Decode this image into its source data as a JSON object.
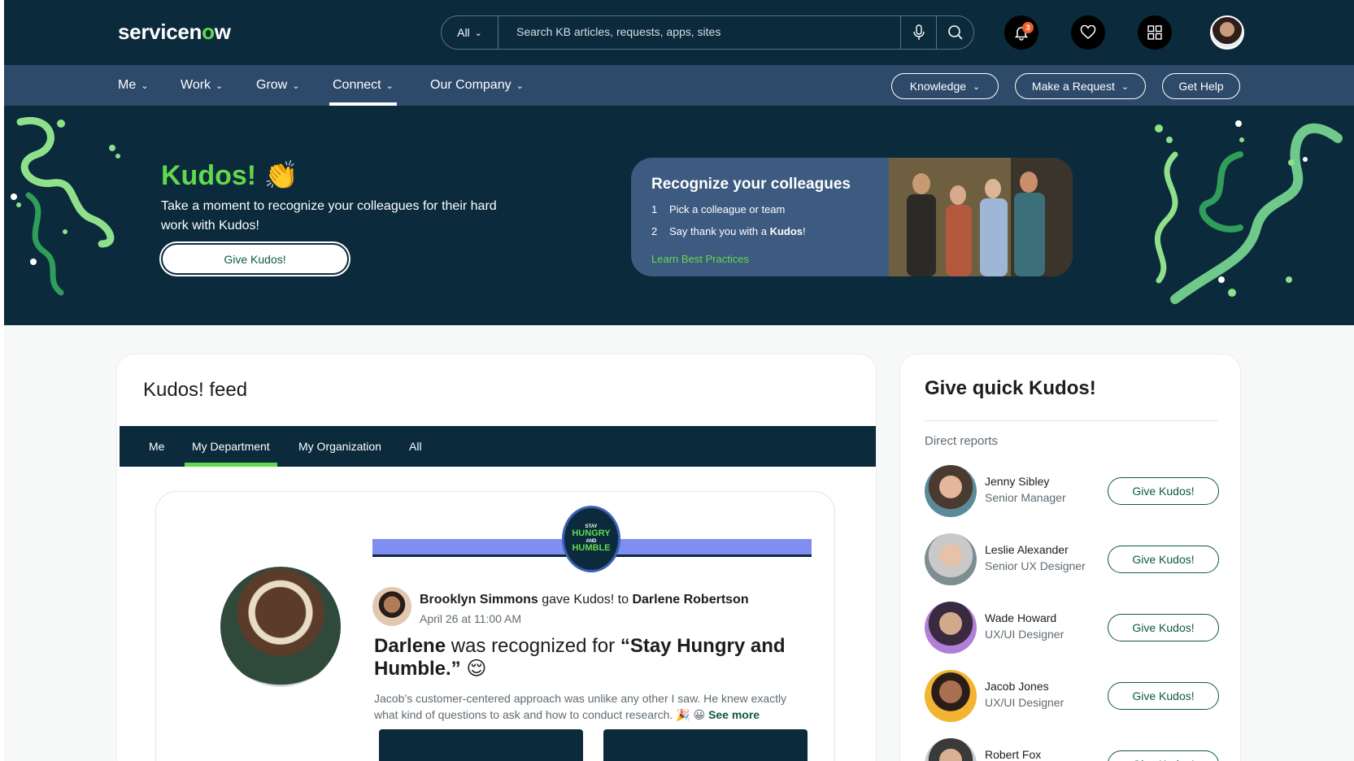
{
  "header": {
    "logo": {
      "prefix": "servicen",
      "o": "o",
      "suffix": "w"
    },
    "search": {
      "scope": "All",
      "placeholder": "Search KB articles, requests, apps, sites"
    },
    "notification_count": "3"
  },
  "nav": {
    "items": [
      {
        "label": "Me"
      },
      {
        "label": "Work"
      },
      {
        "label": "Grow"
      },
      {
        "label": "Connect"
      },
      {
        "label": "Our Company"
      }
    ],
    "pills": {
      "knowledge": "Knowledge",
      "make_request": "Make a Request",
      "get_help": "Get Help"
    }
  },
  "hero": {
    "title": "Kudos! 👏",
    "subtitle": "Take a moment to recognize your colleagues for their hard work with Kudos!",
    "button": "Give Kudos!",
    "recognize": {
      "title": "Recognize your colleagues",
      "steps": [
        {
          "n": "1",
          "text": "Pick a colleague or team"
        },
        {
          "n": "2",
          "text_before": "Say thank you with a ",
          "bold": "Kudos",
          "text_after": "!"
        }
      ],
      "link": "Learn Best Practices"
    }
  },
  "feed": {
    "title": "Kudos! feed",
    "tabs": [
      "Me",
      "My Department",
      "My Organization",
      "All"
    ],
    "post": {
      "seal": {
        "top": "STAY",
        "line1": "HUNGRY",
        "and": "AND",
        "line2": "HUMBLE"
      },
      "giver": "Brooklyn Simmons",
      "action": " gave Kudos! to ",
      "receiver": "Darlene Robertson",
      "date": "April 26 at 11:00 AM",
      "headline_name": "Darlene",
      "headline_mid": " was recognized for ",
      "headline_value": "“Stay Hungry and Humble.”",
      "headline_emoji": " 😌",
      "body": "Jacob’s customer-centered approach was unlike any other I saw. He knew exactly what kind of questions to ask and how to conduct research. 🎉 😀 ",
      "see_more": "See more"
    }
  },
  "quick": {
    "title": "Give quick Kudos!",
    "subtitle": "Direct reports",
    "button": "Give Kudos!",
    "people": [
      {
        "name": "Jenny Sibley",
        "role": "Senior Manager"
      },
      {
        "name": "Leslie Alexander",
        "role": "Senior UX Designer"
      },
      {
        "name": "Wade Howard",
        "role": "UX/UI Designer"
      },
      {
        "name": "Jacob Jones",
        "role": "UX/UI Designer"
      },
      {
        "name": "Robert Fox",
        "role": ""
      }
    ]
  },
  "colors": {
    "navy": "#0b2a3b",
    "nav_blue": "#2d4a6a",
    "accent_green": "#62d84e",
    "button_green": "#0b5b3e"
  }
}
